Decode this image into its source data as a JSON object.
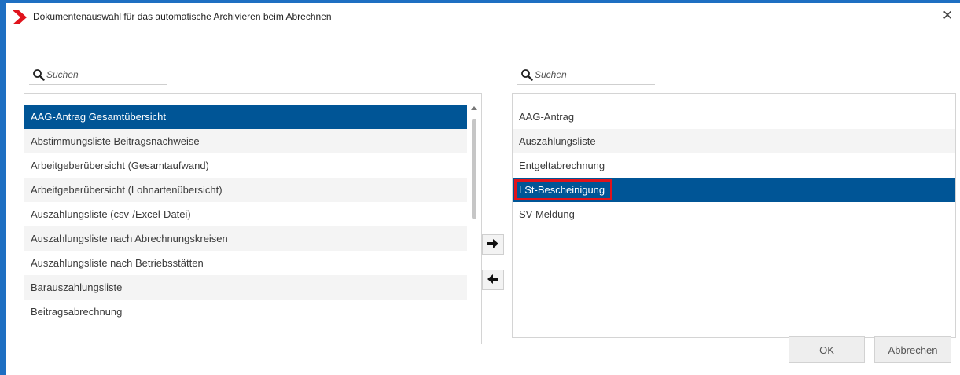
{
  "window": {
    "title": "Dokumentenauswahl für das automatische Archivieren beim Abrechnen"
  },
  "icons": {
    "logo": "red-chevron-logo",
    "close": "close-icon",
    "search": "search-icon",
    "move_right": "arrow-right-icon",
    "move_left": "arrow-left-icon"
  },
  "colors": {
    "accent": "#005596",
    "frame": "#1e6fc2",
    "highlight_box": "#e0131c",
    "logo": "#e0131c"
  },
  "left_panel": {
    "search": {
      "placeholder": "Suchen",
      "value": ""
    },
    "items": [
      {
        "label": "AAG-Antrag Gesamtübersicht",
        "selected": true
      },
      {
        "label": "Abstimmungsliste Beitragsnachweise"
      },
      {
        "label": "Arbeitgeberübersicht (Gesamtaufwand)"
      },
      {
        "label": "Arbeitgeberübersicht (Lohnartenübersicht)"
      },
      {
        "label": "Auszahlungsliste (csv-/Excel-Datei)"
      },
      {
        "label": "Auszahlungsliste nach Abrechnungskreisen"
      },
      {
        "label": "Auszahlungsliste nach Betriebsstätten"
      },
      {
        "label": "Barauszahlungsliste"
      },
      {
        "label": "Beitragsabrechnung"
      }
    ]
  },
  "right_panel": {
    "search": {
      "placeholder": "Suchen",
      "value": ""
    },
    "items": [
      {
        "label": "AAG-Antrag"
      },
      {
        "label": "Auszahlungsliste"
      },
      {
        "label": "Entgeltabrechnung"
      },
      {
        "label": "LSt-Bescheinigung",
        "selected": true,
        "highlighted": true
      },
      {
        "label": "SV-Meldung"
      }
    ]
  },
  "buttons": {
    "ok": "OK",
    "cancel": "Abbrechen"
  }
}
